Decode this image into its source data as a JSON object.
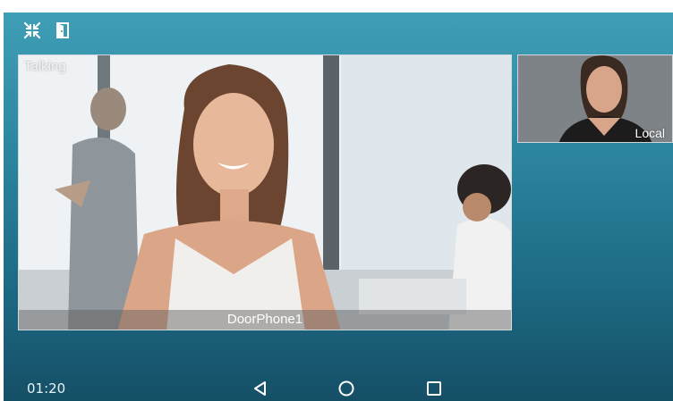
{
  "top_icons": [
    {
      "name": "exit-fullscreen-icon"
    },
    {
      "name": "door-open-icon"
    }
  ],
  "remote_video": {
    "status": "Talking",
    "caller_name": "DoorPhone1"
  },
  "local_video": {
    "label": "Local"
  },
  "call_timer": "01:20",
  "nav_bar": {
    "icons": [
      "back-icon",
      "home-icon",
      "recents-icon"
    ]
  },
  "colors": {
    "background_top": "#3f9fb6",
    "background_bottom": "#154f66",
    "text": "#ffffff"
  }
}
